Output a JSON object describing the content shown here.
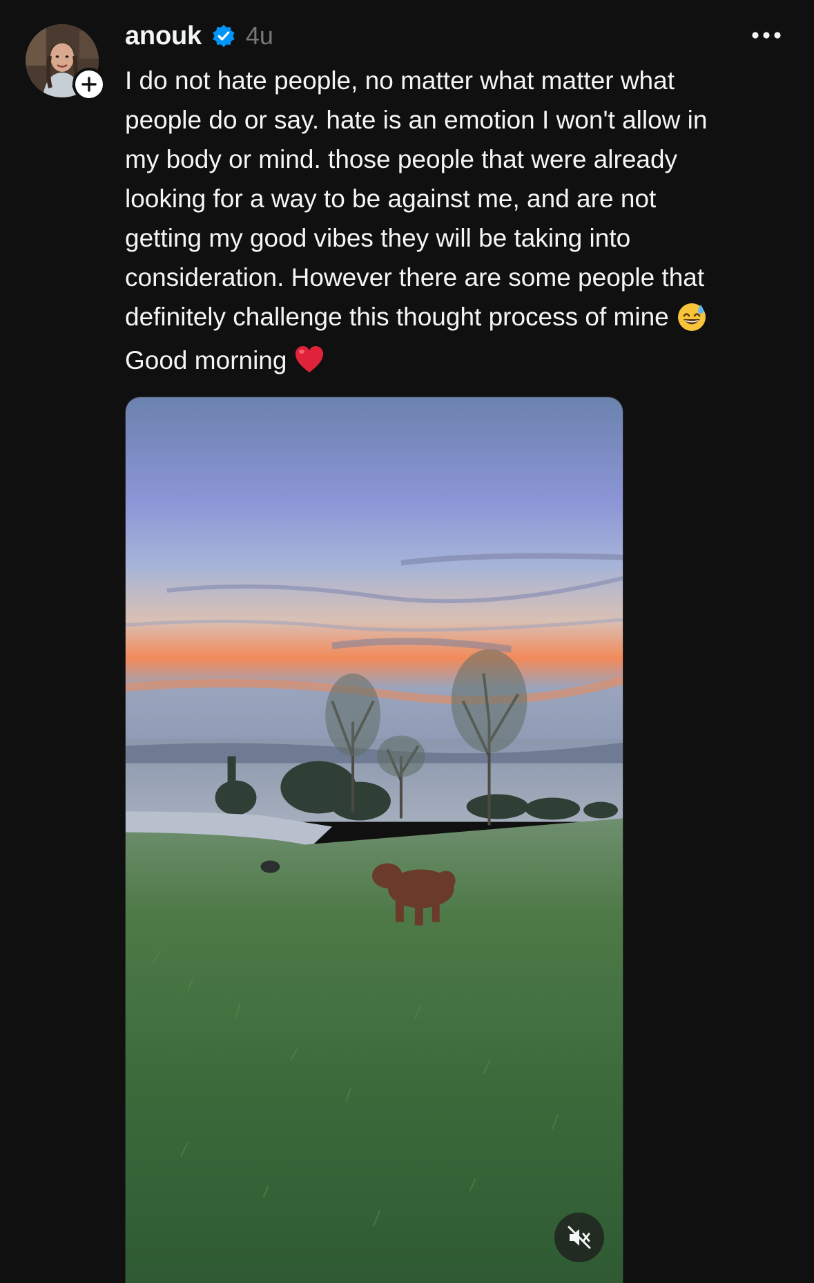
{
  "post": {
    "username": "anouk",
    "verified": true,
    "timestamp": "4u",
    "caption_main": "I do not hate people, no matter what matter what\npeople do or say. hate is an emotion I won't allow in\nmy body or mind. those people that were already\nlooking for a way to be against me, and are not\ngetting my good vibes they will be taking into\nconsideration. However there are some people that\ndefinitely challenge this thought process of mine",
    "caption_emoji_1": "grinning-face-with-sweat-emoji",
    "caption_line2": "Good morning",
    "caption_emoji_2": "red-heart-emoji",
    "media": {
      "type": "video",
      "muted": true
    }
  },
  "icons": {
    "verified": "verified-badge-icon",
    "follow": "plus-icon",
    "more": "more-horizontal-icon",
    "mute": "speaker-muted-icon"
  },
  "colors": {
    "background": "#101010",
    "text": "#f3f5f7",
    "secondary_text": "#777777",
    "verified_blue": "#0095f6"
  }
}
